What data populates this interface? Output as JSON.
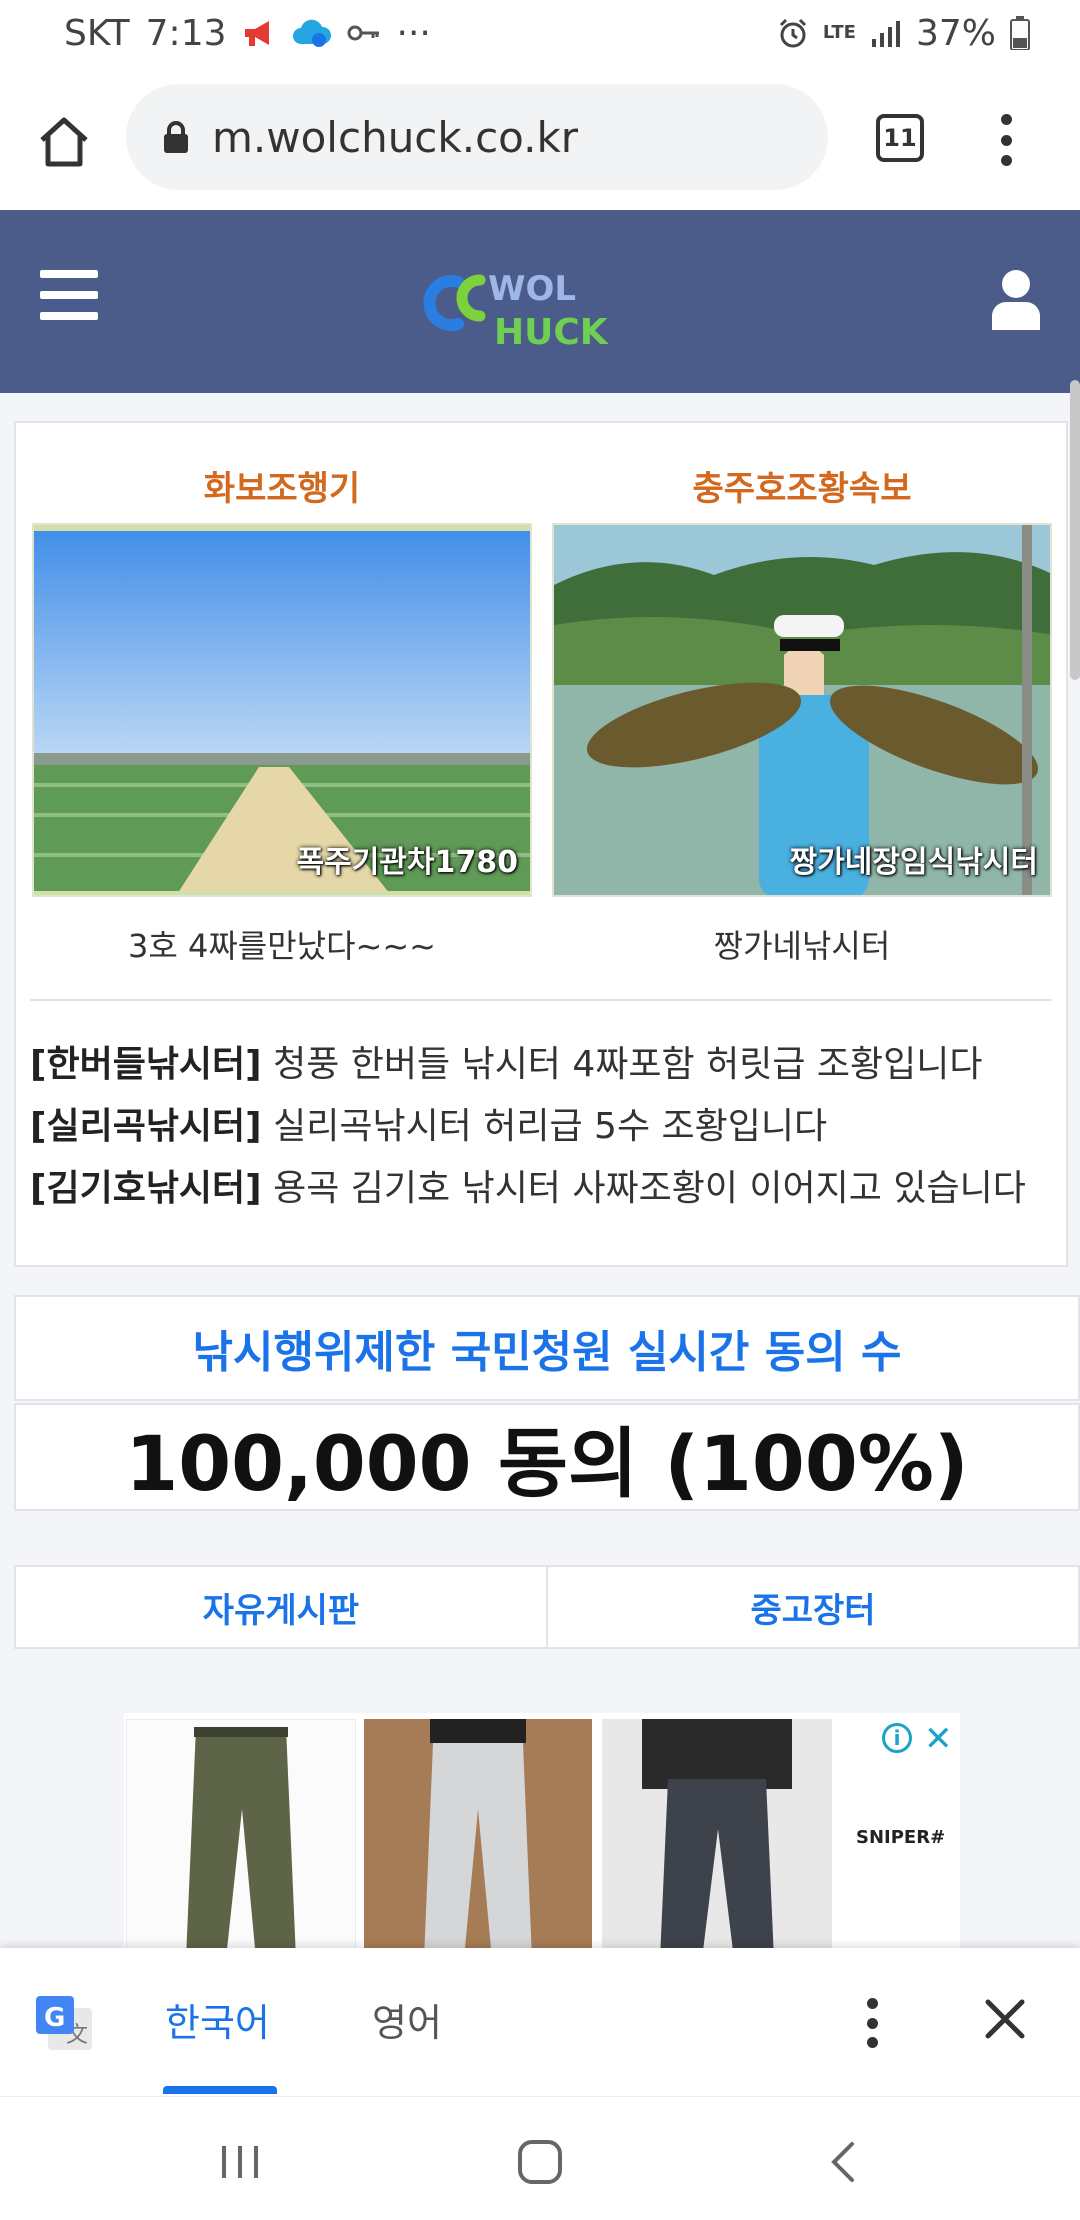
{
  "status_bar": {
    "carrier": "SKT",
    "time": "7:13",
    "more_indicator": "···",
    "network": "LTE",
    "battery": "37%"
  },
  "browser": {
    "url": "m.wolchuck.co.kr",
    "tab_count": "11"
  },
  "site": {
    "logo_text_line1": "WOL",
    "logo_text_line2": "HUCK"
  },
  "featured": [
    {
      "title": "화보조행기",
      "image_label": "폭주기관차1780",
      "caption": "3호 4짜를만났다~~~"
    },
    {
      "title": "충주호조황속보",
      "image_label": "짱가네장임식낚시터",
      "caption": "짱가네낚시터"
    }
  ],
  "news": [
    {
      "tag": "[한버들낚시터]",
      "text": " 청풍 한버들 낚시터 4짜포함 허릿급 조황입니다"
    },
    {
      "tag": "[실리곡낚시터]",
      "text": " 실리곡낚시터 허리급 5수 조황입니다"
    },
    {
      "tag": "[김기호낚시터]",
      "text": " 용곡 김기호 낚시터 사짜조황이 이어지고 있습니다"
    }
  ],
  "petition": {
    "title": "낚시행위제한 국민청원 실시간 동의 수",
    "value": "100,000 동의 (100%)"
  },
  "boards": {
    "free_board": "자유게시판",
    "market": "중고장터"
  },
  "ad": {
    "brand": "SNIPER#",
    "info": "i",
    "close": "✕"
  },
  "translate_bar": {
    "lang_korean": "한국어",
    "lang_english": "영어"
  },
  "colors": {
    "header_bg": "#4b5c8a",
    "accent_blue": "#1a73e8",
    "featured_title": "#d2691e"
  }
}
